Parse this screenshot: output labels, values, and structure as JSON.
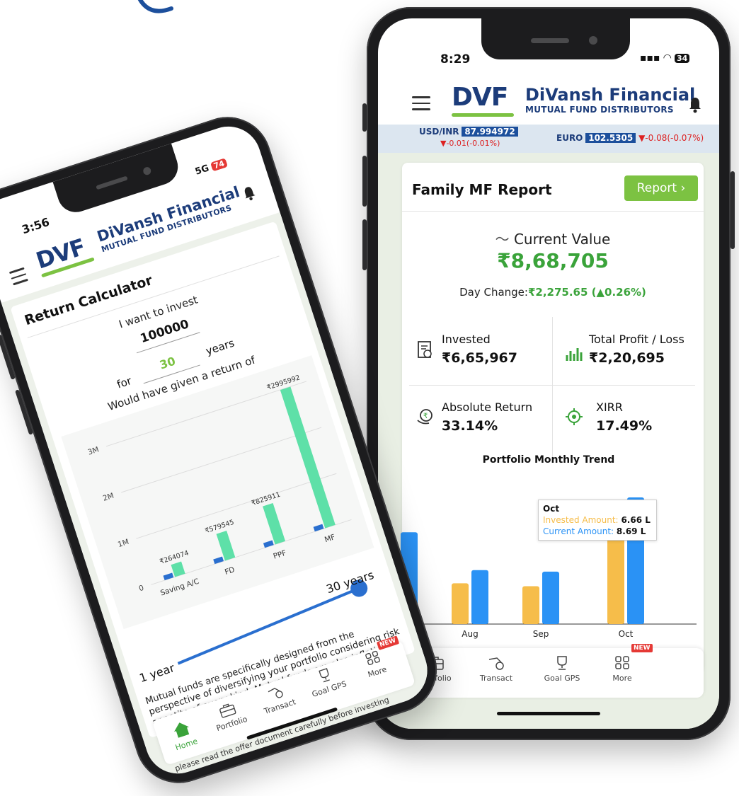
{
  "right_phone": {
    "status": {
      "time": "8:29",
      "battery": "34"
    },
    "header": {
      "logo_mark": "DVF",
      "title": "DiVansh Financial",
      "subtitle": "MUTUAL FUND DISTRIBUTORS"
    },
    "ticker": {
      "usd_label": "USD/INR",
      "usd_value": "87.994972",
      "usd_change": "▼-0.01(-0.01%)",
      "euro_label": "EURO",
      "euro_value": "102.5305",
      "euro_change": "▼-0.08(-0.07%)"
    },
    "report": {
      "title": "Family MF Report",
      "button": "Report",
      "current_value_label": "Current Value",
      "current_value": "₹8,68,705",
      "day_change_label": "Day Change:",
      "day_change_value": "₹2,275.65 (▲0.26%)",
      "metrics": [
        {
          "label": "Invested",
          "value": "₹6,65,967",
          "icon": "invested-icon"
        },
        {
          "label": "Total Profit / Loss",
          "value": "₹2,20,695",
          "icon": "bar-chart-icon"
        },
        {
          "label": "Absolute Return",
          "value": "33.14%",
          "icon": "return-icon"
        },
        {
          "label": "XIRR",
          "value": "17.49%",
          "icon": "target-icon"
        }
      ]
    },
    "trend": {
      "title": "Portfolio Monthly Trend",
      "tooltip": {
        "month": "Oct",
        "invested_label": "Invested Amount:",
        "invested_value": "6.66 L",
        "current_label": "Current Amount:",
        "current_value": "8.69 L"
      }
    },
    "nav": [
      "Portfolio",
      "Transact",
      "Goal GPS",
      "More"
    ],
    "new_badge": "NEW",
    "colors": {
      "invested": "#f6bd4a",
      "current": "#2a92f5",
      "green": "#7cc242",
      "navy": "#1c3c7a"
    }
  },
  "left_phone": {
    "status": {
      "time": "3:56",
      "network": "5G",
      "battery": "74"
    },
    "header": {
      "logo_mark": "DVF",
      "title": "DiVansh Financial",
      "subtitle": "MUTUAL FUND DISTRIBUTORS"
    },
    "calculator": {
      "title": "Return Calculator",
      "invest_label": "I want to invest",
      "amount": "100000",
      "for_label": "for",
      "years_value": "30",
      "years_label": "years",
      "result_label": "Would have given a return of",
      "slider_min_label": "1 year",
      "slider_max_label": "30 years",
      "slider_value": 30,
      "disclaimer": "Mutual funds are specifically designed from the perspective of diversifying your portfolio considering risk appetite of every kind. Mutual funds are also inflation-beating instruments, definitely a great advantage over FD's and PPFs.",
      "footer_note": "please read the offer document carefully before investing"
    },
    "nav": [
      "Home",
      "Portfolio",
      "Transact",
      "Goal GPS",
      "More"
    ],
    "new_badge": "NEW"
  },
  "chart_data": [
    {
      "type": "bar",
      "title": "Portfolio Monthly Trend",
      "categories": [
        "",
        "Aug",
        "Sep",
        "Oct"
      ],
      "series": [
        {
          "name": "Invested Amount",
          "values": [
            null,
            null,
            null,
            6.66
          ]
        },
        {
          "name": "Current Amount",
          "values": [
            null,
            null,
            null,
            8.69
          ]
        }
      ],
      "approx_series": [
        {
          "values": [
            5.3,
            2.8,
            2.6,
            6.66
          ]
        },
        {
          "values": [
            6.3,
            3.7,
            3.6,
            8.69
          ]
        }
      ],
      "ylim": [
        0,
        10
      ]
    },
    {
      "type": "bar",
      "categories": [
        "Saving A/C",
        "FD",
        "PPF",
        "MF"
      ],
      "yticks": [
        "0",
        "1M",
        "2M",
        "3M"
      ],
      "ylim": [
        0,
        3200000
      ],
      "series": [
        {
          "values": [
            100000,
            100000,
            100000,
            100000
          ]
        },
        {
          "values": [
            264074,
            579545,
            825911,
            2995992
          ]
        }
      ],
      "data_labels": [
        "₹264074",
        "₹579545",
        "₹825911",
        "₹2995992"
      ],
      "colors": [
        "#2a6fcf",
        "#5ee0a8"
      ]
    }
  ]
}
